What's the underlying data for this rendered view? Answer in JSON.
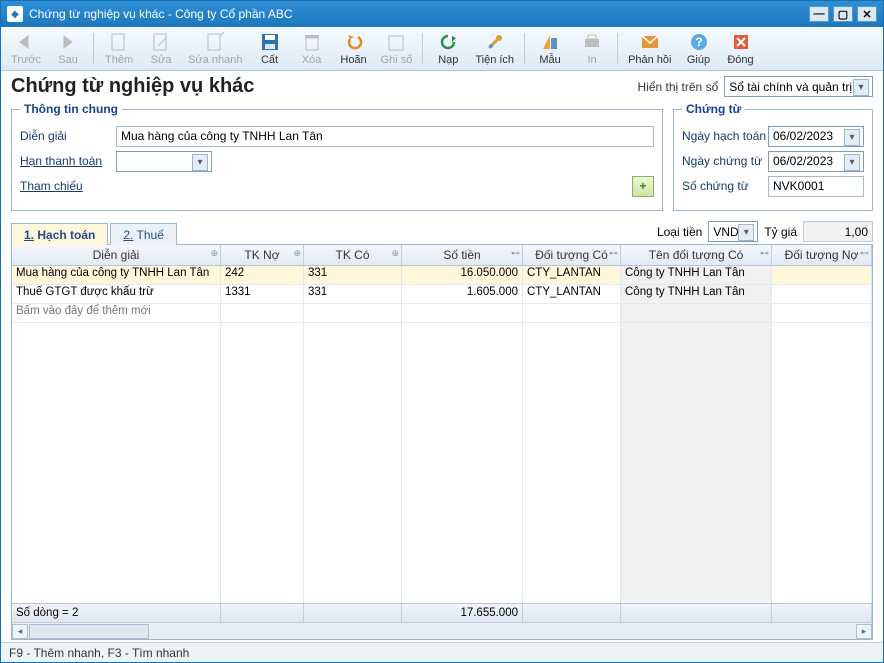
{
  "titlebar": {
    "text": "Chứng từ nghiệp vụ khác - Công ty Cổ phần ABC"
  },
  "toolbar": {
    "truoc": "Trước",
    "sau": "Sau",
    "them": "Thêm",
    "sua": "Sửa",
    "suanhanh": "Sửa nhanh",
    "cat": "Cất",
    "xoa": "Xóa",
    "hoan": "Hoãn",
    "ghiso": "Ghi sổ",
    "nap": "Nạp",
    "tienich": "Tiện ích",
    "mau": "Mẫu",
    "in": "In",
    "phanhoi": "Phản hồi",
    "giup": "Giúp",
    "dong": "Đóng"
  },
  "heading": "Chứng từ nghiệp vụ khác",
  "display_label": "Hiển thị trên sổ",
  "display_value": "Sổ tài chính và quản trị",
  "group_general": "Thông tin chung",
  "group_voucher": "Chứng từ",
  "fields": {
    "diengiai_lbl": "Diễn giải",
    "diengiai_val": "Mua hàng của công ty TNHH Lan Tân",
    "hantt_lbl": "Hạn thanh toán",
    "hantt_val": "",
    "thamchieu_lbl": "Tham chiếu",
    "ngayht_lbl": "Ngày hạch toán",
    "ngayht_val": "06/02/2023",
    "ngayct_lbl": "Ngày chứng từ",
    "ngayct_val": "06/02/2023",
    "soct_lbl": "Số chứng từ",
    "soct_val": "NVK0001"
  },
  "tabs": {
    "t1": "Hạch toán",
    "t1n": "1.",
    "t2": "Thuế",
    "t2n": "2."
  },
  "currency": {
    "loaitien_lbl": "Loại tiền",
    "loaitien_val": "VND",
    "tygia_lbl": "Tỷ giá",
    "tygia_val": "1,00"
  },
  "grid": {
    "cols": {
      "desc": "Diễn giải",
      "dr": "TK Nợ",
      "cr": "TK Có",
      "amt": "Số tiền",
      "oc": "Đối tượng Có",
      "ocn": "Tên đối tượng Có",
      "od": "Đối tượng Nợ"
    },
    "rows": [
      {
        "desc": "Mua hàng của công ty TNHH Lan Tân",
        "dr": "242",
        "cr": "331",
        "amt": "16.050.000",
        "oc": "CTY_LANTAN",
        "ocn": "Công ty TNHH Lan Tân",
        "od": ""
      },
      {
        "desc": "Thuế GTGT được khấu trừ",
        "dr": "1331",
        "cr": "331",
        "amt": "1.605.000",
        "oc": "CTY_LANTAN",
        "ocn": "Công ty TNHH Lan Tân",
        "od": ""
      }
    ],
    "placeholder": "Bấm vào đây để thêm mới",
    "footer_rows": "Số dòng = 2",
    "footer_total": "17.655.000"
  },
  "status": "F9 - Thêm nhanh, F3 - Tìm nhanh"
}
